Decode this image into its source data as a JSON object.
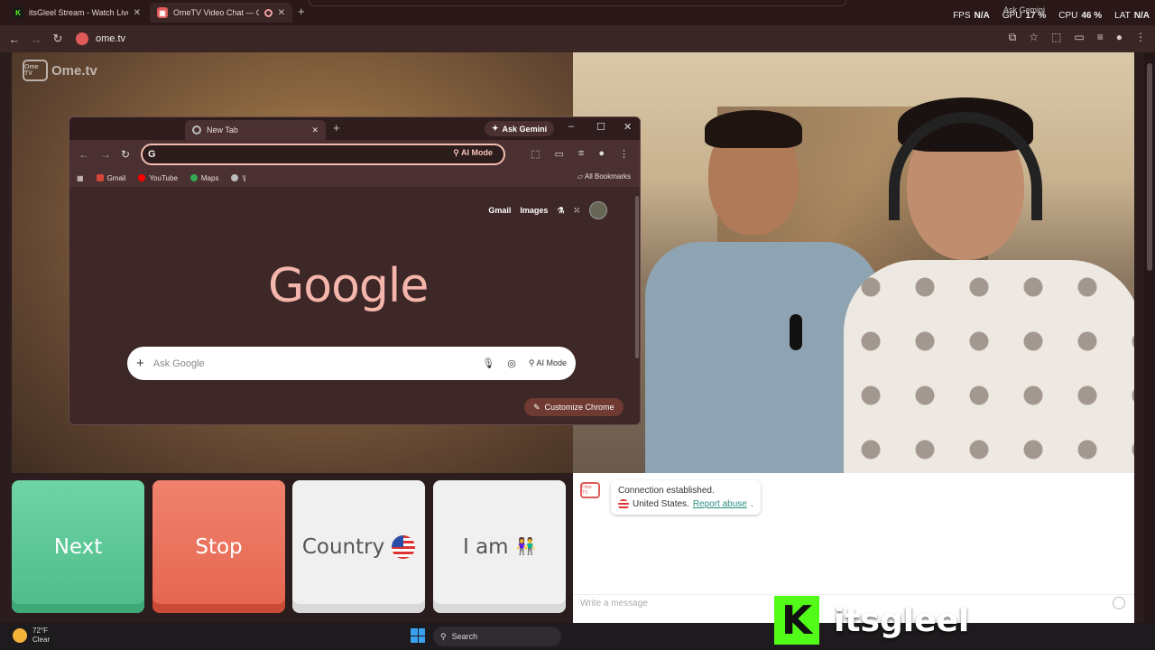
{
  "browser": {
    "tabs": [
      {
        "title": "itsGleel Stream - Watch Live on",
        "icon": "kick-icon"
      },
      {
        "title": "OmeTV Video Chat — Ome",
        "icon": "ometv-icon"
      }
    ],
    "url": "ome.tv"
  },
  "overlay_stats": {
    "fps_label": "FPS",
    "fps_value": "N/A",
    "gpu_label": "GPU",
    "gpu_value": "17 %",
    "cpu_label": "CPU",
    "cpu_value": "46 %",
    "lat_label": "LAT",
    "lat_value": "N/A",
    "ask_gemini": "Ask Gemini"
  },
  "site": {
    "logo_text": "Ome.tv",
    "logo_badge": "Ome TV"
  },
  "overlay_window": {
    "tab_title": "New Tab",
    "ask_gemini": "Ask Gemini",
    "omnibox_letter": "G",
    "ai_mode": "AI Mode",
    "bookmarks": [
      {
        "label": "Gmail",
        "color": "#d44638"
      },
      {
        "label": "YouTube",
        "color": "#ff0000"
      },
      {
        "label": "Maps",
        "color": "#34a853"
      },
      {
        "label": "\\|",
        "color": "#bbbbbb"
      }
    ],
    "all_bookmarks": "All Bookmarks",
    "top_links": [
      "Gmail",
      "Images"
    ],
    "logo": "Google",
    "search_placeholder": "Ask Google",
    "search_ai_mode": "AI Mode",
    "customize": "Customize Chrome"
  },
  "controls": {
    "next": "Next",
    "stop": "Stop",
    "country": "Country",
    "iam": "I am"
  },
  "chat": {
    "line1": "Connection established.",
    "country": "United States.",
    "report": "Report abuse",
    "period": ".",
    "placeholder": "Write a message"
  },
  "taskbar": {
    "temp": "72°F",
    "condition": "Clear",
    "search": "Search"
  },
  "watermark": {
    "k": "K",
    "name": "itsgleel"
  },
  "colors": {
    "next": "#5cc897",
    "stop": "#ea6f58",
    "accent_kick": "#53fc18",
    "google_logo": "#f4b5aa"
  }
}
